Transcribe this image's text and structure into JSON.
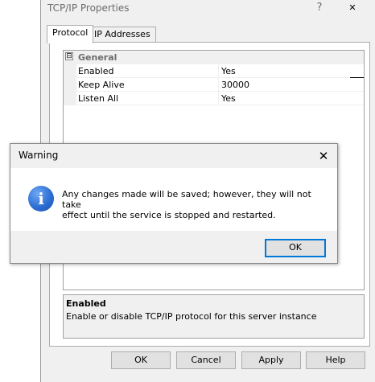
{
  "window": {
    "title": "TCP/IP Properties",
    "help_glyph": "?",
    "close_glyph": "✕",
    "tabs": [
      {
        "label": "Protocol",
        "active": true
      },
      {
        "label": "IP Addresses",
        "active": false
      }
    ],
    "category": {
      "label": "General",
      "expander": "⊟"
    },
    "properties": [
      {
        "name": "Enabled",
        "value": "Yes"
      },
      {
        "name": "Keep Alive",
        "value": "30000"
      },
      {
        "name": "Listen All",
        "value": "Yes"
      }
    ],
    "description": {
      "title": "Enabled",
      "text": "Enable or disable TCP/IP protocol for this server instance"
    },
    "buttons": {
      "ok": "OK",
      "cancel": "Cancel",
      "apply": "Apply",
      "help": "Help"
    }
  },
  "dialog": {
    "title": "Warning",
    "close_glyph": "✕",
    "icon": "information-icon",
    "icon_glyph": "i",
    "message_line1": "Any changes made will be saved; however, they will not take",
    "message_line2": "effect until the service is stopped and restarted.",
    "ok_label": "OK"
  }
}
